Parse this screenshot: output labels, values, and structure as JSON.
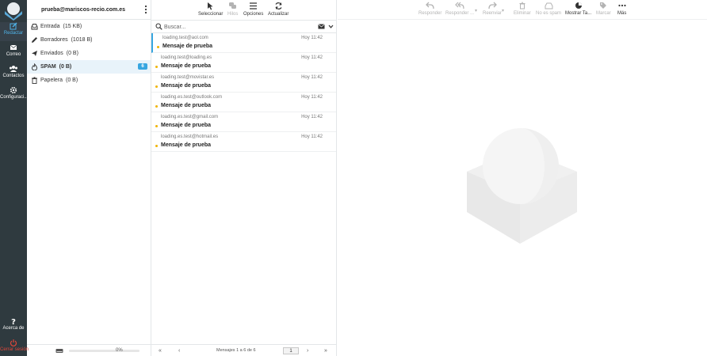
{
  "rail": {
    "items": [
      {
        "label": "Redactar",
        "icon": "compose-icon"
      },
      {
        "label": "Correo",
        "icon": "mail-icon"
      },
      {
        "label": "Contactos",
        "icon": "contacts-icon"
      },
      {
        "label": "Configuraci...",
        "icon": "gear-icon"
      },
      {
        "label": "Acerca de",
        "icon": "help-icon"
      },
      {
        "label": "Cerrar sesión",
        "icon": "power-icon"
      }
    ]
  },
  "account": {
    "email": "prueba@mariscos-recio.com.es"
  },
  "folders": [
    {
      "name": "Entrada",
      "size": "(15 KB)",
      "icon": "inbox-icon"
    },
    {
      "name": "Borradores",
      "size": "(1018 B)",
      "icon": "pencil-icon"
    },
    {
      "name": "Enviados",
      "size": "(0 B)",
      "icon": "send-icon"
    },
    {
      "name": "SPAM",
      "size": "(0 B)",
      "icon": "fire-icon",
      "badge": "6"
    },
    {
      "name": "Papelera",
      "size": "(0 B)",
      "icon": "trash-icon"
    }
  ],
  "quota": {
    "percent_label": "0%",
    "used_fraction": 0
  },
  "list_toolbar": {
    "select": "Seleccionar",
    "threads": "Hilos",
    "options": "Opciones",
    "refresh": "Actualizar"
  },
  "search": {
    "placeholder": "Buscar..."
  },
  "messages": [
    {
      "from": "loading.test@aol.com",
      "date": "Hoy 11:42",
      "subject": "Mensaje de prueba"
    },
    {
      "from": "loading.test@loading.es",
      "date": "Hoy 11:42",
      "subject": "Mensaje de prueba"
    },
    {
      "from": "loading.test@movistar.es",
      "date": "Hoy 11:42",
      "subject": "Mensaje de prueba"
    },
    {
      "from": "loading.es.test@outlook.com",
      "date": "Hoy 11:42",
      "subject": "Mensaje de prueba"
    },
    {
      "from": "loading.es.test@gmail.com",
      "date": "Hoy 11:42",
      "subject": "Mensaje de prueba"
    },
    {
      "from": "loading.es.test@hotmail.es",
      "date": "Hoy 11:42",
      "subject": "Mensaje de prueba"
    }
  ],
  "pager": {
    "count_label": "Mensajes 1 a 6 de 6",
    "page": "1"
  },
  "preview_toolbar": {
    "reply": "Responder",
    "reply_all": "Responder ...",
    "forward": "Reenviar",
    "delete": "Eliminar",
    "not_spam": "No es spam",
    "show_tags": "Mostrar Ta...",
    "mark": "Marcar",
    "more": "Más"
  },
  "colors": {
    "rail_bg": "#2f3a3f",
    "accent": "#37a6e0",
    "logout": "#e0463a",
    "unread_dot": "#f0b400"
  }
}
